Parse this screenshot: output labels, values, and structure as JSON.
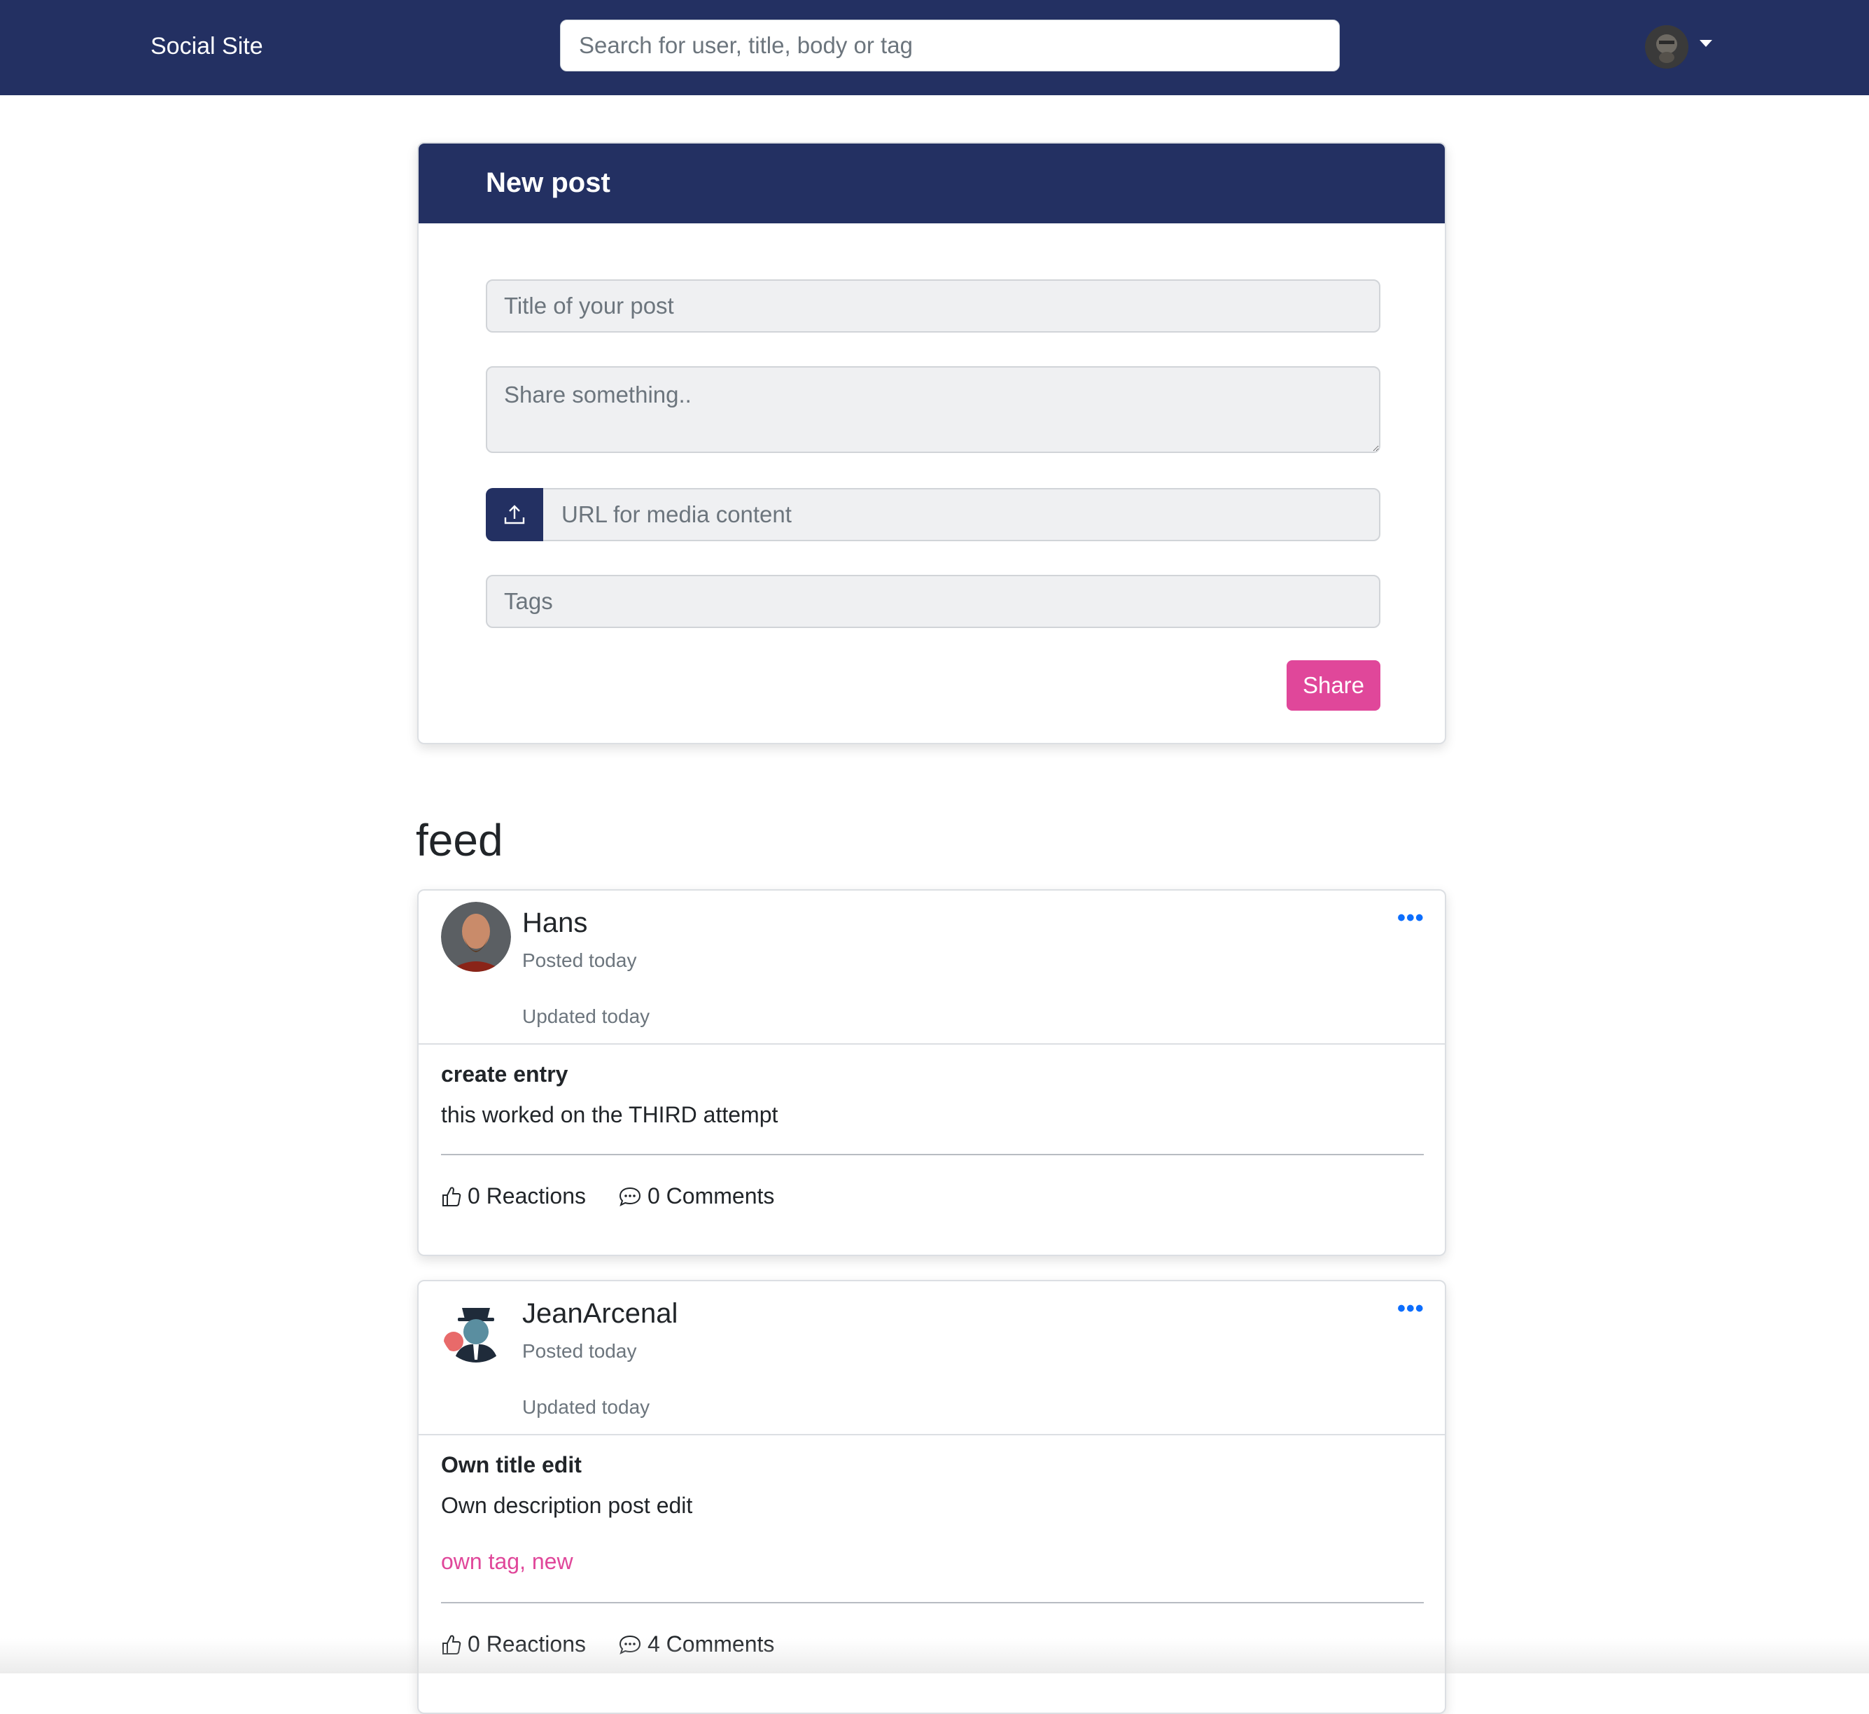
{
  "navbar": {
    "brand": "Social Site",
    "search_placeholder": "Search for user, title, body or tag"
  },
  "new_post": {
    "header": "New post",
    "title_placeholder": "Title of your post",
    "body_placeholder": "Share something..",
    "url_placeholder": "URL for media content",
    "tags_placeholder": "Tags",
    "share_label": "Share"
  },
  "feed": {
    "title": "feed",
    "posts": [
      {
        "username": "Hans",
        "posted": "Posted today",
        "updated": "Updated today",
        "title": "create entry",
        "body": "this worked on the THIRD attempt",
        "tags": "",
        "reactions": "0 Reactions",
        "comments": "0 Comments"
      },
      {
        "username": "JeanArcenal",
        "posted": "Posted today",
        "updated": "Updated today",
        "title": "Own title edit",
        "body": "Own description post edit",
        "tags": "own tag, new",
        "reactions": "0 Reactions",
        "comments": "4 Comments"
      }
    ]
  },
  "icons": {
    "menu": "ellipsis-icon",
    "reaction": "thumbs-up-icon",
    "comment": "chat-bubble-icon",
    "upload": "upload-icon"
  },
  "colors": {
    "brand": "#233062",
    "accent": "#e0479a",
    "link": "#0d6efd"
  }
}
